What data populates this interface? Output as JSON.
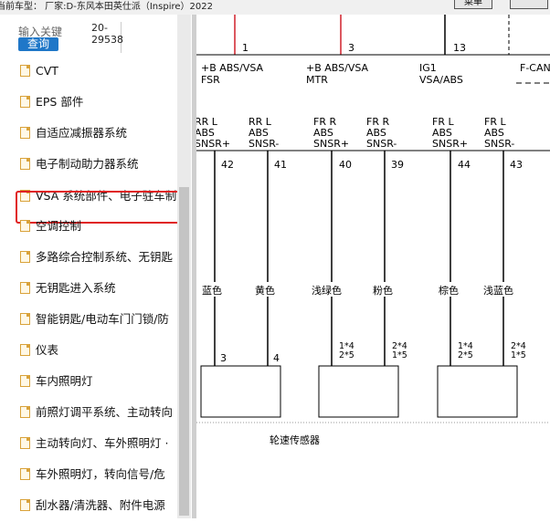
{
  "header": {
    "current_car": "当前车型：  厂家:D-东风本田英仕派（Inspire）2022",
    "btn_right_1": "菜单",
    "btn_right_2": ""
  },
  "sidebar": {
    "search_label": "输入关键",
    "search_code": "20-\n29538",
    "search_button": "查询",
    "items": [
      {
        "label": "CVT"
      },
      {
        "label": "EPS 部件"
      },
      {
        "label": "自适应减振器系统"
      },
      {
        "label": "电子制动助力器系统"
      },
      {
        "label": "VSA 系统部件、电子驻车制动"
      },
      {
        "label": "空调控制"
      },
      {
        "label": "多路综合控制系统、无钥匙"
      },
      {
        "label": "无钥匙进入系统"
      },
      {
        "label": "智能钥匙/电动车门门锁/防"
      },
      {
        "label": "仪表"
      },
      {
        "label": "车内照明灯"
      },
      {
        "label": "前照灯调平系统、主动转向"
      },
      {
        "label": "主动转向灯、车外照明灯 ·"
      },
      {
        "label": "车外照明灯，转向信号/危"
      },
      {
        "label": "刮水器/清洗器、附件电源"
      }
    ]
  },
  "diagram": {
    "top_pins": [
      "1",
      "3",
      "13"
    ],
    "circuits": [
      {
        "line1": "+B ABS/VSA",
        "line2": "FSR"
      },
      {
        "line1": "+B ABS/VSA",
        "line2": "MTR"
      },
      {
        "line1": "IG1",
        "line2": "VSA/ABS"
      },
      {
        "line1": "F-CAN",
        "line2": ""
      }
    ],
    "signals": [
      {
        "l1": "RR L",
        "l2": "ABS",
        "l3": "SNSR+",
        "pin": "42",
        "color": "蓝色",
        "conn": "3"
      },
      {
        "l1": "RR L",
        "l2": "ABS",
        "l3": "SNSR-",
        "pin": "41",
        "color": "黄色",
        "conn": "4"
      },
      {
        "l1": "FR R",
        "l2": "ABS",
        "l3": "SNSR+",
        "pin": "40",
        "color": "浅绿色",
        "conn_a": "1*4",
        "conn_b": "2*5"
      },
      {
        "l1": "FR R",
        "l2": "ABS",
        "l3": "SNSR-",
        "pin": "39",
        "color": "粉色",
        "conn_a": "2*4",
        "conn_b": "1*5"
      },
      {
        "l1": "FR L",
        "l2": "ABS",
        "l3": "SNSR+",
        "pin": "44",
        "color": "棕色",
        "conn_a": "1*4",
        "conn_b": "2*5"
      },
      {
        "l1": "FR L",
        "l2": "ABS",
        "l3": "SNSR-",
        "pin": "43",
        "color": "浅蓝色",
        "conn_a": "2*4",
        "conn_b": "1*5"
      }
    ],
    "sensor_label": "轮速传感器"
  }
}
